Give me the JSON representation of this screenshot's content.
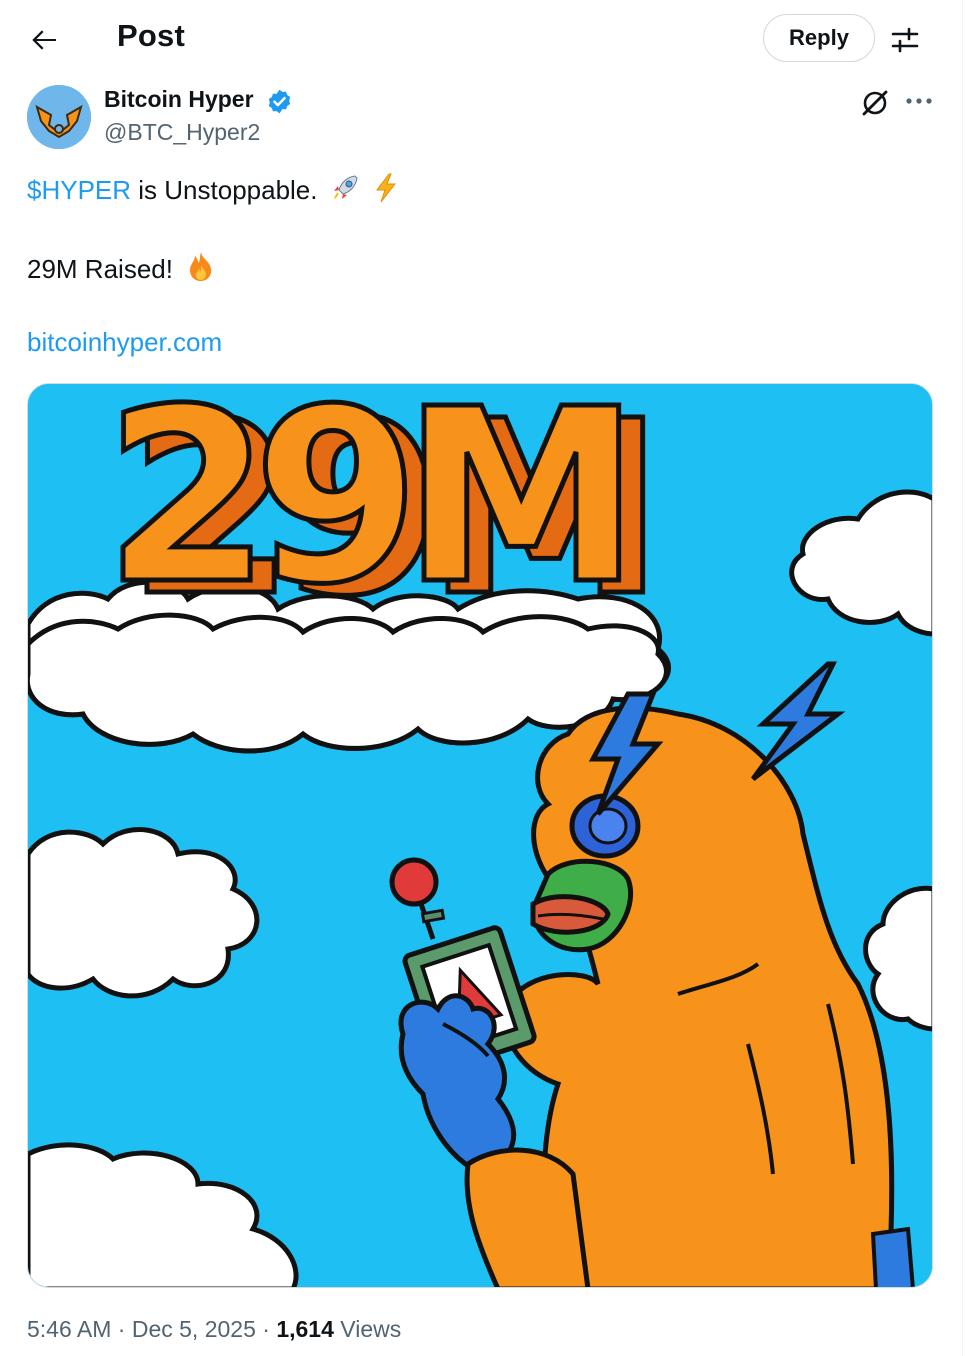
{
  "header": {
    "title": "Post",
    "reply_label": "Reply"
  },
  "author": {
    "name": "Bitcoin Hyper",
    "handle": "@BTC_Hyper2",
    "verified": true
  },
  "post": {
    "ticker": "$HYPER",
    "line1_rest": " is Unstoppable.",
    "line1_emojis": [
      "rocket",
      "high-voltage"
    ],
    "line2": "29M Raised!",
    "line2_emoji": "fire",
    "link": "bitcoinhyper.com"
  },
  "media": {
    "headline": "29M",
    "background_color": "#1ec0f4",
    "accent_color": "#f7931a"
  },
  "meta": {
    "time": "5:46 AM",
    "separator": " · ",
    "date": "Dec 5, 2025",
    "views_count": "1,614",
    "views_label": " Views"
  },
  "colors": {
    "link": "#1d9bf0",
    "secondary_text": "#536471",
    "verified": "#1d9bf0"
  }
}
